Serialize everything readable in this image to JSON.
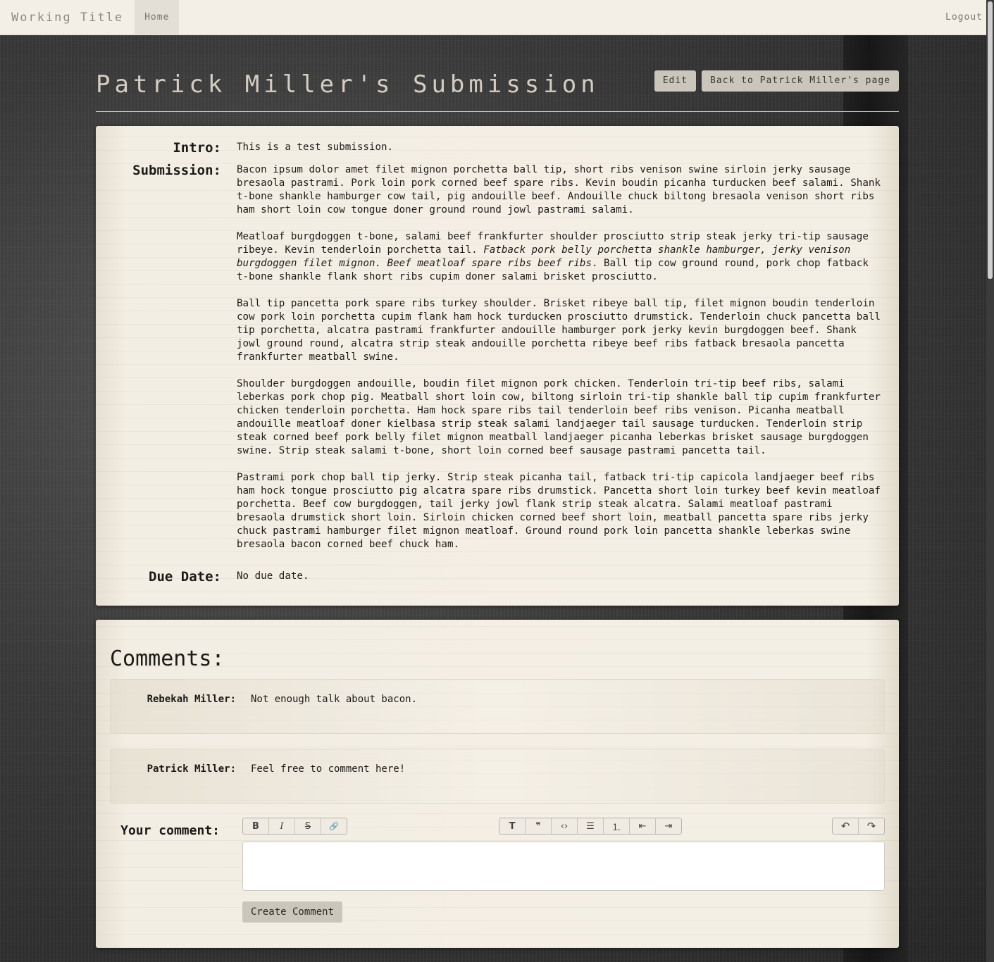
{
  "nav": {
    "brand": "Working Title",
    "home": "Home",
    "logout": "Logout"
  },
  "header": {
    "title": "Patrick Miller's Submission",
    "edit_label": "Edit",
    "back_label": "Back to Patrick Miller's page"
  },
  "submission": {
    "intro_label": "Intro:",
    "intro_text": "This is a test submission.",
    "submission_label": "Submission:",
    "paragraphs": {
      "p1": "Bacon ipsum dolor amet filet mignon porchetta ball tip, short ribs venison swine sirloin jerky sausage bresaola pastrami. Pork loin pork corned beef spare ribs. Kevin boudin picanha turducken beef salami. Shank t-bone shankle hamburger cow tail, pig andouille beef. Andouille chuck biltong bresaola venison short ribs ham short loin cow tongue doner ground round jowl pastrami salami.",
      "p2_start": "Meatloaf burgdoggen t-bone, salami beef frankfurter shoulder prosciutto strip steak jerky tri-tip sausage ribeye. Kevin tenderloin porchetta tail. ",
      "p2_italic": "Fatback pork belly porchetta shankle hamburger, jerky venison burgdoggen filet mignon. Beef meatloaf spare ribs beef ribs",
      "p2_end": ". Ball tip cow ground round, pork chop fatback t-bone shankle flank short ribs cupim doner salami brisket prosciutto.",
      "p3": "Ball tip pancetta pork spare ribs turkey shoulder. Brisket ribeye ball tip, filet mignon boudin tenderloin cow pork loin porchetta cupim flank ham hock turducken prosciutto drumstick. Tenderloin chuck pancetta ball tip porchetta, alcatra pastrami frankfurter andouille hamburger pork jerky kevin burgdoggen beef. Shank jowl ground round, alcatra strip steak andouille porchetta ribeye beef ribs fatback bresaola pancetta frankfurter meatball swine.",
      "p4": "Shoulder burgdoggen andouille, boudin filet mignon pork chicken. Tenderloin tri-tip beef ribs, salami leberkas pork chop pig. Meatball short loin cow, biltong sirloin tri-tip shankle ball tip cupim frankfurter chicken tenderloin porchetta. Ham hock spare ribs tail tenderloin beef ribs venison. Picanha meatball andouille meatloaf doner kielbasa strip steak salami landjaeger tail sausage turducken. Tenderloin strip steak corned beef pork belly filet mignon meatball landjaeger picanha leberkas brisket sausage burgdoggen swine. Strip steak salami t-bone, short loin corned beef sausage pastrami pancetta tail.",
      "p5": "Pastrami pork chop ball tip jerky. Strip steak picanha tail, fatback tri-tip capicola landjaeger beef ribs ham hock tongue prosciutto pig alcatra spare ribs drumstick. Pancetta short loin turkey beef kevin meatloaf porchetta. Beef cow burgdoggen, tail jerky jowl flank strip steak alcatra. Salami meatloaf pastrami bresaola drumstick short loin. Sirloin chicken corned beef short loin, meatball pancetta spare ribs jerky chuck pastrami hamburger filet mignon meatloaf. Ground round pork loin pancetta shankle leberkas swine bresaola bacon corned beef chuck ham."
    },
    "due_label": "Due Date:",
    "due_text": "No due date."
  },
  "comments": {
    "title": "Comments:",
    "items": [
      {
        "author": "Rebekah Miller:",
        "body": "Not enough talk about bacon."
      },
      {
        "author": "Patrick Miller:",
        "body": "Feel free to comment here!"
      }
    ],
    "your_comment_label": "Your comment:",
    "toolbar": {
      "bold": "B",
      "italic": "I",
      "strike": "S",
      "link": "🔗",
      "heading": "T",
      "quote": "❞",
      "code": "‹›",
      "bullet": "☰",
      "numbered": "⒈",
      "outdent": "⇤",
      "indent": "⇥",
      "undo": "↶",
      "redo": "↷"
    },
    "editor_value": "",
    "create_label": "Create Comment"
  }
}
